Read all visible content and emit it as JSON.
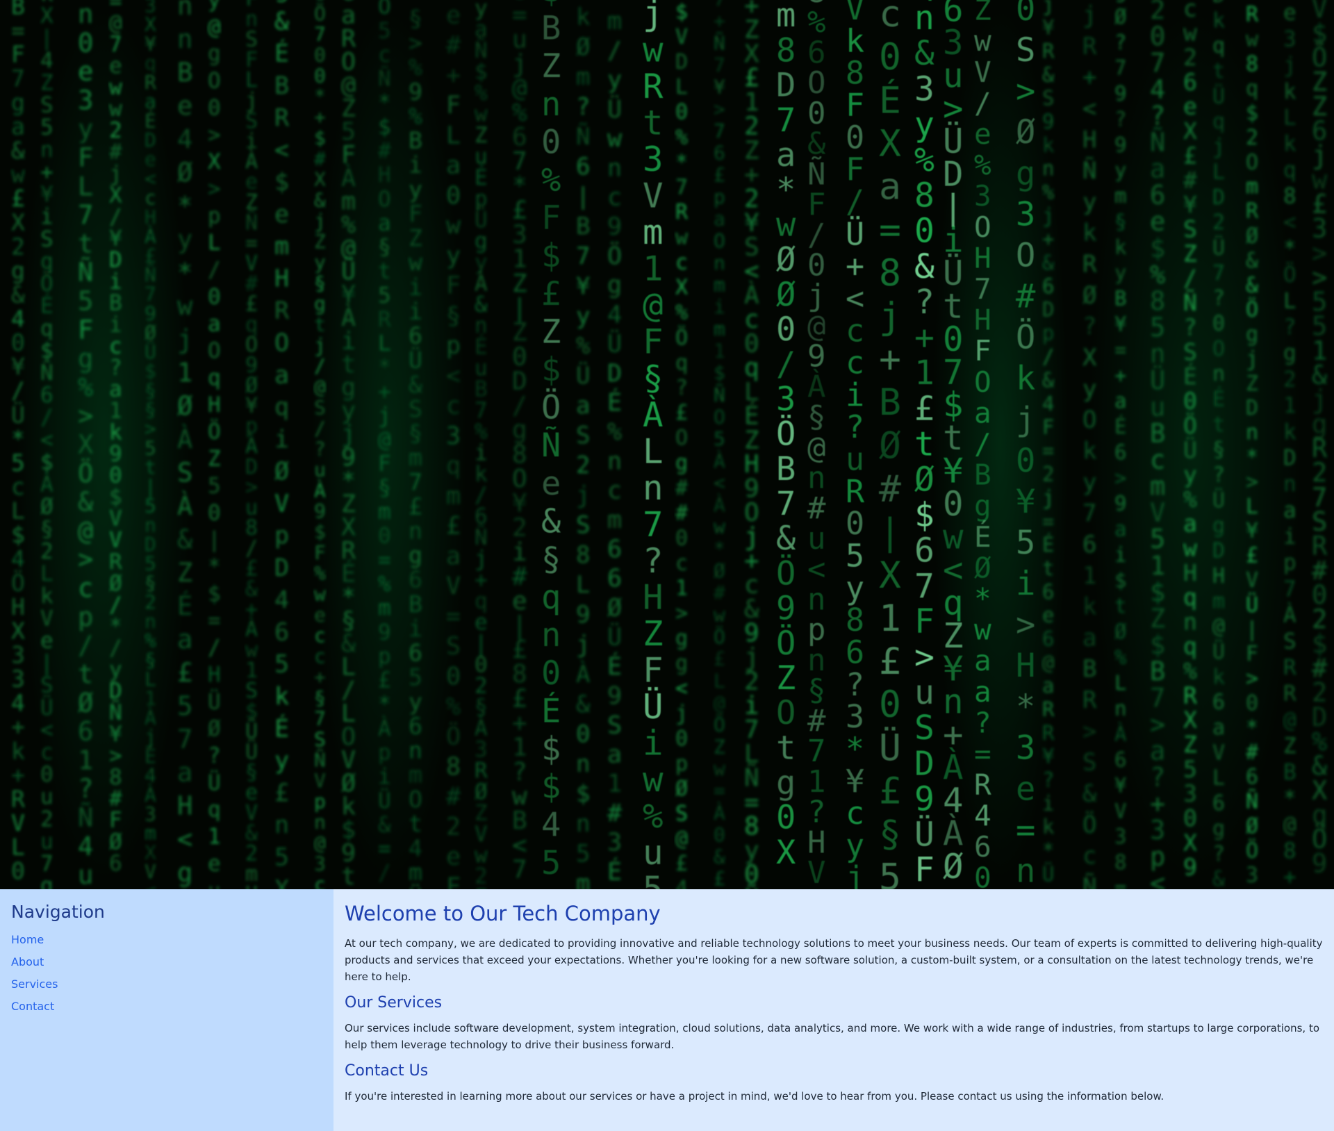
{
  "hero": {
    "image": "green-code-rain-matrix-background",
    "colors": {
      "bg": "#020602",
      "glyph": "#1fbf55",
      "glyph_bright": "#7fe6a0"
    }
  },
  "sidebar": {
    "title": "Navigation",
    "links": [
      {
        "label": "Home"
      },
      {
        "label": "About"
      },
      {
        "label": "Services"
      },
      {
        "label": "Contact"
      }
    ],
    "colors": {
      "bg": "#bfdbfe",
      "title": "#1e3a8a",
      "link": "#2563eb"
    }
  },
  "main": {
    "title": "Welcome to Our Tech Company",
    "intro": "At our tech company, we are dedicated to providing innovative and reliable technology solutions to meet your business needs. Our team of experts is committed to delivering high-quality products and services that exceed your expectations. Whether you're looking for a new software solution, a custom-built system, or a consultation on the latest technology trends, we're here to help.",
    "services_heading": "Our Services",
    "services_text": "Our services include software development, system integration, cloud solutions, data analytics, and more. We work with a wide range of industries, from startups to large corporations, to help them leverage technology to drive their business forward.",
    "contact_heading": "Contact Us",
    "contact_text": "If you're interested in learning more about our services or have a project in mind, we'd love to hear from you. Please contact us using the information below.",
    "colors": {
      "bg": "#dbeafe",
      "heading": "#1e40af",
      "text": "#1f2937"
    }
  }
}
